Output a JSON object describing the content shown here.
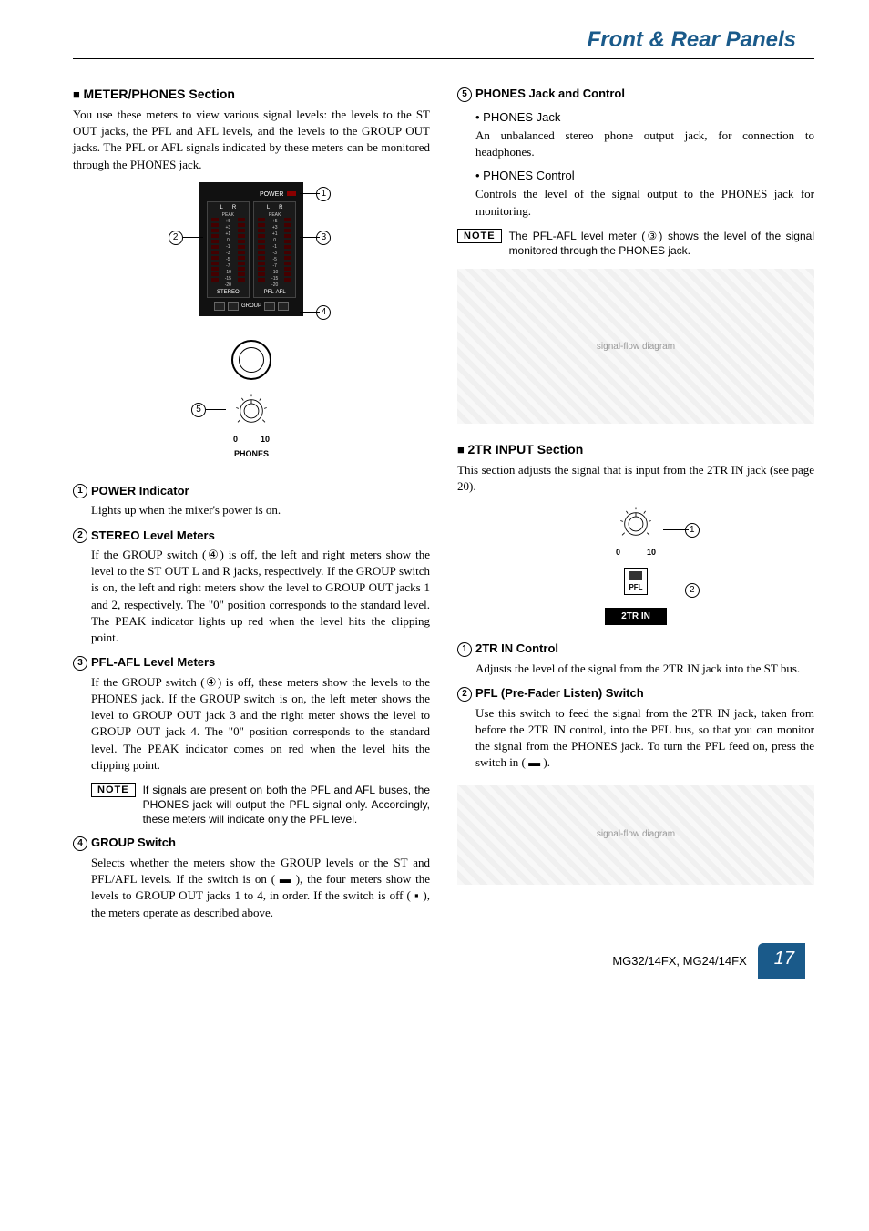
{
  "header": {
    "title": "Front & Rear Panels"
  },
  "left": {
    "section1": {
      "title": "METER/PHONES Section",
      "intro": "You use these meters to view various signal levels: the levels to the ST OUT jacks, the PFL and AFL levels, and the levels to the GROUP OUT jacks. The PFL or AFL signals indicated by these meters can be monitored through the PHONES jack."
    },
    "meter_fig": {
      "power_label": "POWER",
      "lr": [
        "L",
        "R"
      ],
      "scale": [
        "PEAK",
        "+5",
        "+3",
        "+1",
        "0",
        "-1",
        "-3",
        "-5",
        "-7",
        "-10",
        "-15",
        "-20"
      ],
      "stereo_label": "STEREO",
      "pflafl_label": "PFL·AFL",
      "group_label": "GROUP",
      "knob_min": "0",
      "knob_max": "10",
      "phones_label": "PHONES"
    },
    "items": [
      {
        "num": "1",
        "title": "POWER Indicator",
        "body": "Lights up when the mixer's power is on."
      },
      {
        "num": "2",
        "title": "STEREO Level Meters",
        "body": "If the GROUP switch (④) is off, the left and right meters show the level to the ST OUT L and R jacks, respectively. If the GROUP switch is on, the left and right meters show the level to GROUP OUT jacks 1 and 2, respectively. The \"0\" position corresponds to the standard level. The PEAK indicator lights up red when the level hits the clipping point."
      },
      {
        "num": "3",
        "title": "PFL-AFL Level Meters",
        "body": "If the GROUP switch (④) is off, these meters show the levels to the PHONES jack. If the GROUP switch is on, the left meter shows the level to GROUP OUT jack 3 and the right meter shows the level to GROUP OUT jack 4. The \"0\" position corresponds to the standard level. The PEAK indicator comes on red when the level hits the clipping point."
      },
      {
        "num": "4",
        "title": "GROUP Switch",
        "body": "Selects whether the meters show the GROUP levels or the ST and PFL/AFL levels. If the switch is on ( ▬ ), the four meters show the levels to GROUP OUT jacks 1 to 4, in order. If the switch is off ( ▪ ), the meters operate as described above."
      }
    ],
    "note1": {
      "label": "NOTE",
      "text": "If signals are present on both the PFL and AFL buses, the PHONES jack will output the PFL signal only. Accordingly, these meters will indicate only the PFL level."
    }
  },
  "right": {
    "item5": {
      "num": "5",
      "title": "PHONES Jack and Control",
      "sub1_title": "• PHONES Jack",
      "sub1_body": "An unbalanced stereo phone output jack, for connection to headphones.",
      "sub2_title": "• PHONES Control",
      "sub2_body": "Controls the level of the signal output to the PHONES jack for monitoring."
    },
    "note2": {
      "label": "NOTE",
      "text": "The PFL-AFL level meter (③) shows the level of the signal monitored through the PHONES jack."
    },
    "section2": {
      "title": "2TR INPUT Section",
      "intro": "This section adjusts the signal that is input from the 2TR IN jack (see page 20)."
    },
    "twotr_fig": {
      "knob_min": "0",
      "knob_max": "10",
      "pfl_label": "PFL",
      "bar_label": "2TR IN"
    },
    "items2": [
      {
        "num": "1",
        "title": "2TR IN Control",
        "body": "Adjusts the level of the signal from the 2TR IN jack into the ST bus."
      },
      {
        "num": "2",
        "title": "PFL (Pre-Fader Listen) Switch",
        "body": "Use this switch to feed the signal from the 2TR IN jack, taken from before the 2TR IN control, into the PFL bus, so that you can monitor the signal from the PHONES jack. To turn the PFL feed on, press the switch in ( ▬ )."
      }
    ]
  },
  "footer": {
    "model": "MG32/14FX, MG24/14FX",
    "page": "17"
  }
}
